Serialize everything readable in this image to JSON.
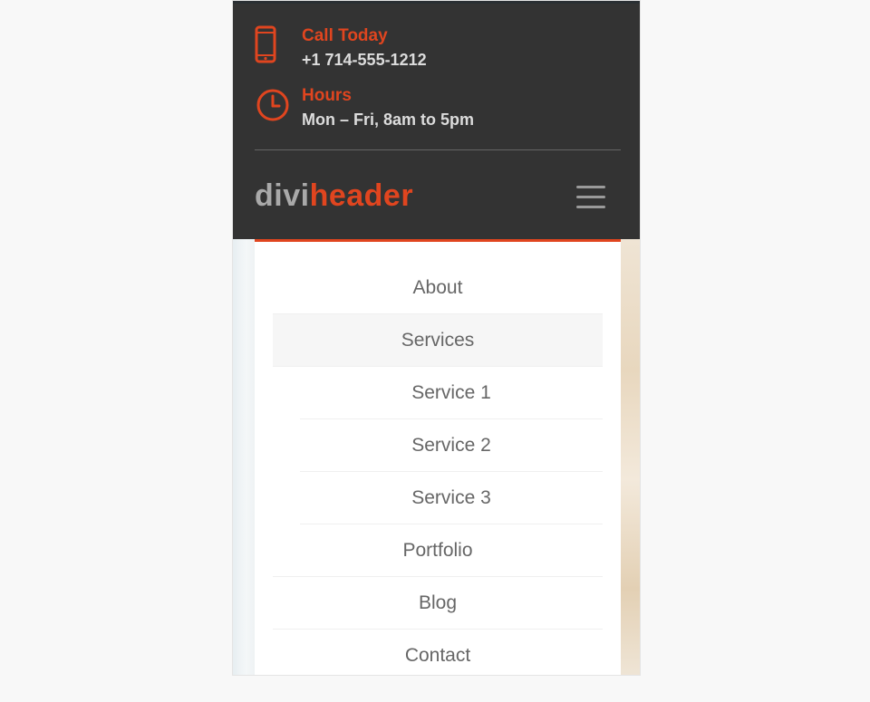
{
  "topbar": {
    "call": {
      "title": "Call Today",
      "value": "+1 714-555-1212",
      "icon": "phone-icon"
    },
    "hours": {
      "title": "Hours",
      "value": "Mon – Fri, 8am to 5pm",
      "icon": "clock-icon"
    }
  },
  "logo": {
    "part1": "divi",
    "part2": "header"
  },
  "menu": {
    "items": [
      {
        "label": "About"
      },
      {
        "label": "Services"
      },
      {
        "label": "Service 1"
      },
      {
        "label": "Service 2"
      },
      {
        "label": "Service 3"
      },
      {
        "label": "Portfolio"
      },
      {
        "label": "Blog"
      },
      {
        "label": "Contact"
      }
    ]
  },
  "colors": {
    "accent": "#e0451f",
    "header_bg": "#333333",
    "menu_text": "#666666"
  }
}
